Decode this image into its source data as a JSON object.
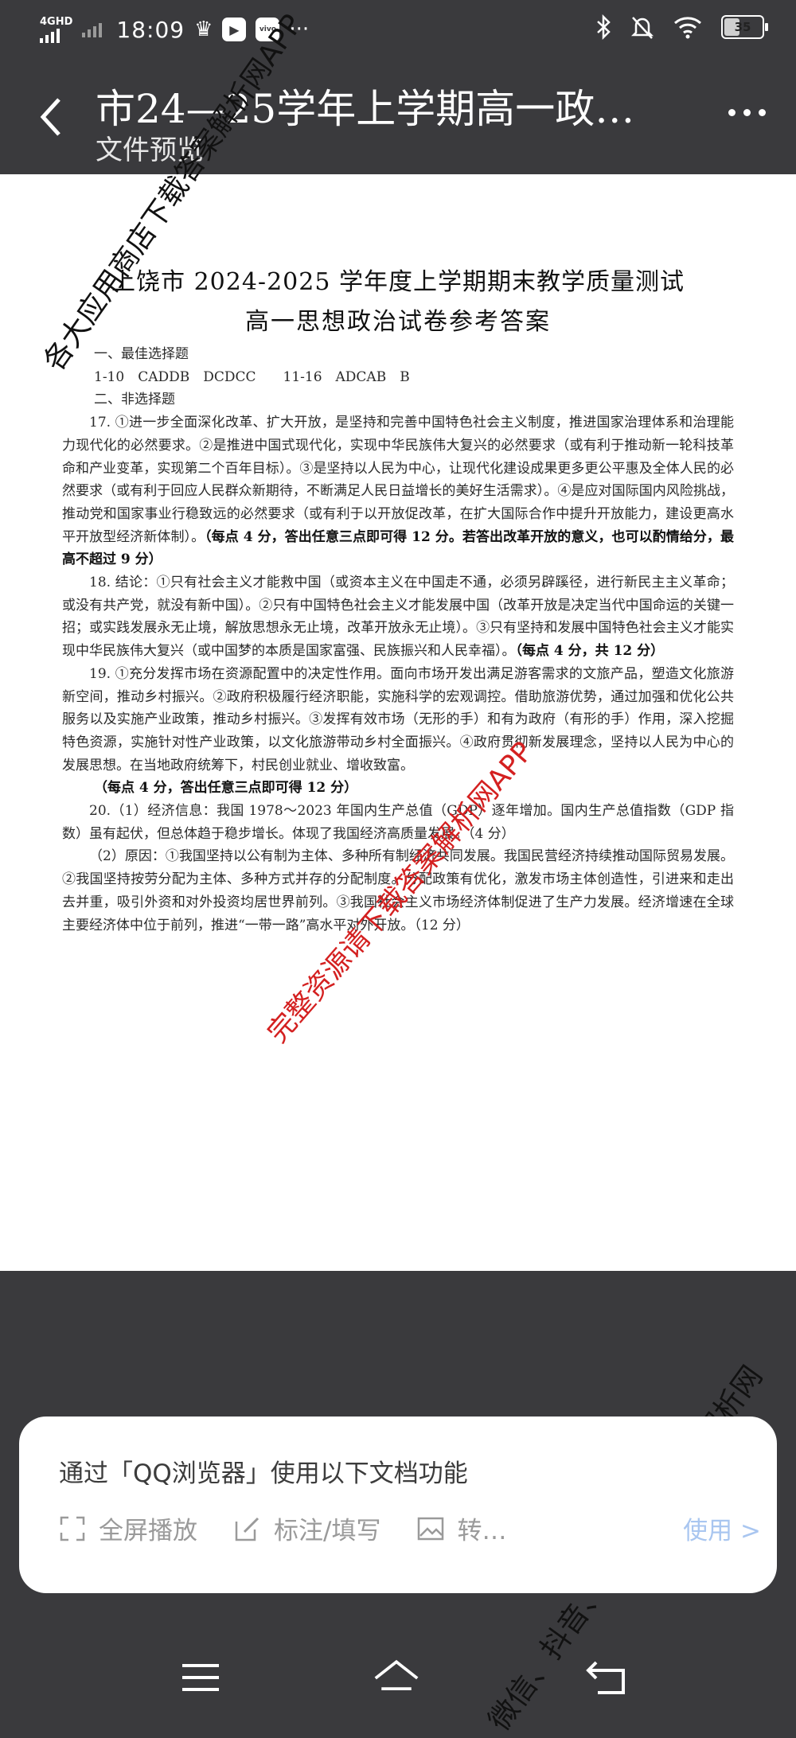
{
  "status_bar": {
    "network": "4GHD",
    "time": "18:09",
    "app_icon_label": "vivo",
    "more": "···",
    "battery": "35"
  },
  "header": {
    "title": "市24—25学年上学期高一政…",
    "subtitle": "文件预览"
  },
  "document": {
    "title": "上饶市 2024-2025 学年度上学期期末教学质量测试",
    "subtitle": "高一思想政治试卷参考答案",
    "paragraphs": [
      {
        "text": "一、最佳选择题",
        "style": "sec"
      },
      {
        "text": "1-10　CADDB　DCDCC　　11-16　ADCAB　B",
        "style": "sec"
      },
      {
        "text": "二、非选择题",
        "style": "sec"
      },
      {
        "text": "17. ①进一步全面深化改革、扩大开放，是坚持和完善中国特色社会主义制度，推进国家治理体系和治理能力现代化的必然要求。②是推进中国式现代化，实现中华民族伟大复兴的必然要求（或有利于推动新一轮科技革命和产业变革，实现第二个百年目标）。③是坚持以人民为中心，让现代化建设成果更多更公平惠及全体人民的必然要求（或有利于回应人民群众新期待，不断满足人民日益增长的美好生活需求）。④是应对国际国内风险挑战，推动党和国家事业行稳致远的必然要求（或有利于以开放促改革，在扩大国际合作中提升开放能力，建设更高水平开放型经济新体制）。",
        "bold": "（每点 4 分，答出任意三点即可得 12 分。若答出改革开放的意义，也可以酌情给分，最高不超过 9 分）",
        "style": "para"
      },
      {
        "text": "18. 结论：①只有社会主义才能救中国（或资本主义在中国走不通，必须另辟蹊径，进行新民主主义革命；或没有共产党，就没有新中国）。②只有中国特色社会主义才能发展中国（改革开放是决定当代中国命运的关键一招；或实践发展永无止境，解放思想永无止境，改革开放永无止境）。③只有坚持和发展中国特色社会主义才能实现中华民族伟大复兴（或中国梦的本质是国家富强、民族振兴和人民幸福）。",
        "bold": "（每点 4 分，共 12 分）",
        "style": "para"
      },
      {
        "text": "19. ①充分发挥市场在资源配置中的决定性作用。面向市场开发出满足游客需求的文旅产品，塑造文化旅游新空间，推动乡村振兴。②政府积极履行经济职能，实施科学的宏观调控。借助旅游优势，通过加强和优化公共服务以及实施产业政策，推动乡村振兴。③发挥有效市场（无形的手）和有为政府（有形的手）作用，深入挖掘特色资源，实施针对性产业政策，以文化旅游带动乡村全面振兴。④政府贯彻新发展理念，坚持以人民为中心的发展思想。在当地政府统筹下，村民创业就业、增收致富。",
        "bold": "",
        "style": "para"
      },
      {
        "text": "",
        "bold": "（每点 4 分，答出任意三点即可得 12 分）",
        "style": "noindent"
      },
      {
        "text": "20.（1）经济信息：我国 1978～2023 年国内生产总值（GDP）逐年增加。国内生产总值指数（GDP 指数）虽有起伏，但总体趋于稳步增长。体现了我国经济高质量发展。（4 分）",
        "bold": "",
        "style": "para"
      },
      {
        "text": "（2）原因：①我国坚持以公有制为主体、多种所有制经济共同发展。我国民营经济持续推动国际贸易发展。②我国坚持按劳分配为主体、多种方式并存的分配制度。分配政策有优化，激发市场主体创造性，引进来和走出去并重，吸引外资和对外投资均居世界前列。③我国社会主义市场经济体制促进了生产力发展。经济增速在全球主要经济体中位于前列，推进“一带一路”高水平对外开放。（12 分）",
        "bold": "",
        "style": "para"
      }
    ]
  },
  "watermarks": {
    "w1": "各大应用商店下载答案解析网APP",
    "w2": "完整资源请下载答案解析网APP",
    "w3": "微信、抖音、快手搜索答案解析网"
  },
  "panel": {
    "text": "通过「QQ浏览器」使用以下文档功能",
    "tools": [
      "全屏播放",
      "标注/填写",
      "转…"
    ],
    "use": "使用 >"
  }
}
